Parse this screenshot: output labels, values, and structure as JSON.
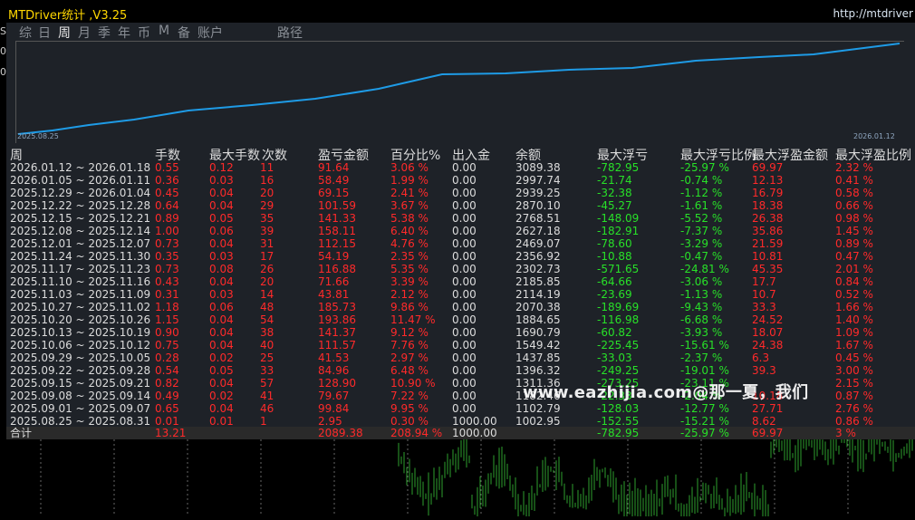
{
  "titlebar": {
    "title": "MTDriver统计 ,V3.25",
    "url": "http://mtdriver"
  },
  "tabs": [
    "综",
    "日",
    "周",
    "月",
    "季",
    "年",
    "币",
    "M",
    "备",
    "账户",
    "路径"
  ],
  "active_tab": "周",
  "chart": {
    "start_label": "2025.08.25",
    "end_label": "2026.01.12",
    "line_color": "#1e9be6"
  },
  "headers": [
    "周",
    "手数",
    "最大手数",
    "次数",
    "盈亏金额",
    "百分比%",
    "出入金",
    "余额",
    "最大浮亏",
    "最大浮亏比例",
    "最大浮盈金额",
    "最大浮盈比例"
  ],
  "rows": [
    [
      "2026.01.12 ~ 2026.01.18",
      "0.55",
      "0.12",
      "11",
      "91.64",
      "3.06 %",
      "0.00",
      "3089.38",
      "-782.95",
      "-25.97 %",
      "69.97",
      "2.32 %"
    ],
    [
      "2026.01.05 ~ 2026.01.11",
      "0.36",
      "0.03",
      "16",
      "58.49",
      "1.99 %",
      "0.00",
      "2997.74",
      "-21.74",
      "-0.74 %",
      "12.13",
      "0.41 %"
    ],
    [
      "2025.12.29 ~ 2026.01.04",
      "0.45",
      "0.04",
      "20",
      "69.15",
      "2.41 %",
      "0.00",
      "2939.25",
      "-32.38",
      "-1.12 %",
      "16.79",
      "0.58 %"
    ],
    [
      "2025.12.22 ~ 2025.12.28",
      "0.64",
      "0.04",
      "29",
      "101.59",
      "3.67 %",
      "0.00",
      "2870.10",
      "-45.27",
      "-1.61 %",
      "18.38",
      "0.66 %"
    ],
    [
      "2025.12.15 ~ 2025.12.21",
      "0.89",
      "0.05",
      "35",
      "141.33",
      "5.38 %",
      "0.00",
      "2768.51",
      "-148.09",
      "-5.52 %",
      "26.38",
      "0.98 %"
    ],
    [
      "2025.12.08 ~ 2025.12.14",
      "1.00",
      "0.06",
      "39",
      "158.11",
      "6.40 %",
      "0.00",
      "2627.18",
      "-182.91",
      "-7.37 %",
      "35.86",
      "1.45 %"
    ],
    [
      "2025.12.01 ~ 2025.12.07",
      "0.73",
      "0.04",
      "31",
      "112.15",
      "4.76 %",
      "0.00",
      "2469.07",
      "-78.60",
      "-3.29 %",
      "21.59",
      "0.89 %"
    ],
    [
      "2025.11.24 ~ 2025.11.30",
      "0.35",
      "0.03",
      "17",
      "54.19",
      "2.35 %",
      "0.00",
      "2356.92",
      "-10.88",
      "-0.47 %",
      "10.81",
      "0.47 %"
    ],
    [
      "2025.11.17 ~ 2025.11.23",
      "0.73",
      "0.08",
      "26",
      "116.88",
      "5.35 %",
      "0.00",
      "2302.73",
      "-571.65",
      "-24.81 %",
      "45.35",
      "2.01 %"
    ],
    [
      "2025.11.10 ~ 2025.11.16",
      "0.43",
      "0.04",
      "20",
      "71.66",
      "3.39 %",
      "0.00",
      "2185.85",
      "-64.66",
      "-3.06 %",
      "17.7",
      "0.84 %"
    ],
    [
      "2025.11.03 ~ 2025.11.09",
      "0.31",
      "0.03",
      "14",
      "43.81",
      "2.12 %",
      "0.00",
      "2114.19",
      "-23.69",
      "-1.13 %",
      "10.7",
      "0.52 %"
    ],
    [
      "2025.10.27 ~ 2025.11.02",
      "1.18",
      "0.06",
      "48",
      "185.73",
      "9.86 %",
      "0.00",
      "2070.38",
      "-189.69",
      "-9.43 %",
      "33.3",
      "1.66 %"
    ],
    [
      "2025.10.20 ~ 2025.10.26",
      "1.15",
      "0.04",
      "54",
      "193.86",
      "11.47 %",
      "0.00",
      "1884.65",
      "-116.98",
      "-6.68 %",
      "24.52",
      "1.40 %"
    ],
    [
      "2025.10.13 ~ 2025.10.19",
      "0.90",
      "0.04",
      "38",
      "141.37",
      "9.12 %",
      "0.00",
      "1690.79",
      "-60.82",
      "-3.93 %",
      "18.07",
      "1.09 %"
    ],
    [
      "2025.10.06 ~ 2025.10.12",
      "0.75",
      "0.04",
      "40",
      "111.57",
      "7.76 %",
      "0.00",
      "1549.42",
      "-225.45",
      "-15.61 %",
      "24.38",
      "1.67 %"
    ],
    [
      "2025.09.29 ~ 2025.10.05",
      "0.28",
      "0.02",
      "25",
      "41.53",
      "2.97 %",
      "0.00",
      "1437.85",
      "-33.03",
      "-2.37 %",
      "6.3",
      "0.45 %"
    ],
    [
      "2025.09.22 ~ 2025.09.28",
      "0.54",
      "0.05",
      "33",
      "84.96",
      "6.48 %",
      "0.00",
      "1396.32",
      "-249.25",
      "-19.01 %",
      "39.3",
      "3.00 %"
    ],
    [
      "2025.09.15 ~ 2025.09.21",
      "0.82",
      "0.04",
      "57",
      "128.90",
      "10.90 %",
      "0.00",
      "1311.36",
      "-273.25",
      "-23.11 %",
      "",
      "2.15 %"
    ],
    [
      "2025.09.08 ~ 2025.09.14",
      "0.49",
      "0.02",
      "41",
      "79.67",
      "7.22 %",
      "0.00",
      "1182.46",
      "-22.33",
      "-2.04 %",
      "10.18",
      "0.87 %"
    ],
    [
      "2025.09.01 ~ 2025.09.07",
      "0.65",
      "0.04",
      "46",
      "99.84",
      "9.95 %",
      "0.00",
      "1102.79",
      "-128.03",
      "-12.77 %",
      "27.71",
      "2.76 %"
    ],
    [
      "2025.08.25 ~ 2025.08.31",
      "0.01",
      "0.01",
      "1",
      "2.95",
      "0.30 %",
      "1000.00",
      "1002.95",
      "-152.55",
      "-15.21 %",
      "8.62",
      "0.86 %"
    ]
  ],
  "total": [
    "合计",
    "13.21",
    "",
    "",
    "2089.38",
    "208.94 %",
    "1000.00",
    "",
    "-782.95",
    "-25.97 %",
    "69.97",
    "3 %"
  ],
  "watermark": "www.eazhijia.com@那一夏，我们",
  "left_edge_marks": [
    "S",
    "0",
    "0"
  ]
}
